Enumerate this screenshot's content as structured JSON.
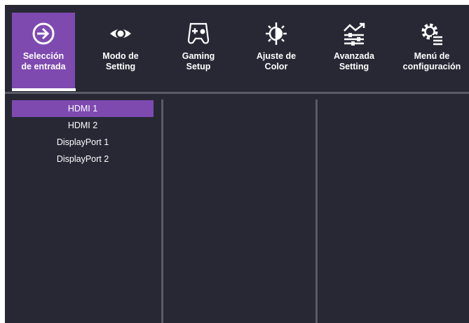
{
  "tabs": [
    {
      "label": "Selección\nde entrada",
      "icon": "input-arrow-icon",
      "active": true
    },
    {
      "label": "Modo de\nSetting",
      "icon": "eye-icon",
      "active": false
    },
    {
      "label": "Gaming\nSetup",
      "icon": "gamepad-icon",
      "active": false
    },
    {
      "label": "Ajuste de\nColor",
      "icon": "color-adjust-icon",
      "active": false
    },
    {
      "label": "Avanzada\nSetting",
      "icon": "advanced-settings-icon",
      "active": false
    },
    {
      "label": "Menú de\nconfiguración",
      "icon": "settings-menu-icon",
      "active": false
    }
  ],
  "input_list": {
    "items": [
      "HDMI 1",
      "HDMI 2",
      "DisplayPort 1",
      "DisplayPort 2"
    ],
    "selected_index": 0
  },
  "colors": {
    "background": "#272834",
    "accent": "#7e4ab0",
    "divider": "#5a5b66",
    "text": "#ffffff"
  }
}
